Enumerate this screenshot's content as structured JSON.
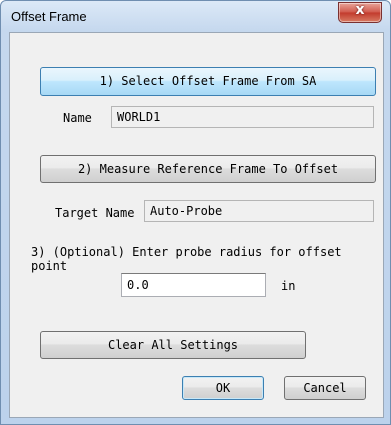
{
  "window": {
    "title": "Offset Frame",
    "close_glyph": "x"
  },
  "step1": {
    "button_label": "1) Select Offset Frame From SA",
    "name_label": "Name",
    "name_value": "WORLD1"
  },
  "step2": {
    "button_label": "2) Measure Reference Frame To Offset",
    "target_label": "Target Name",
    "target_value": "Auto-Probe"
  },
  "step3": {
    "instruction": "3) (Optional) Enter probe radius for offset point",
    "radius_value": "0.0",
    "unit": "in"
  },
  "actions": {
    "clear_label": "Clear All Settings",
    "ok_label": "OK",
    "cancel_label": "Cancel"
  },
  "icons": {
    "close": "close-icon"
  }
}
